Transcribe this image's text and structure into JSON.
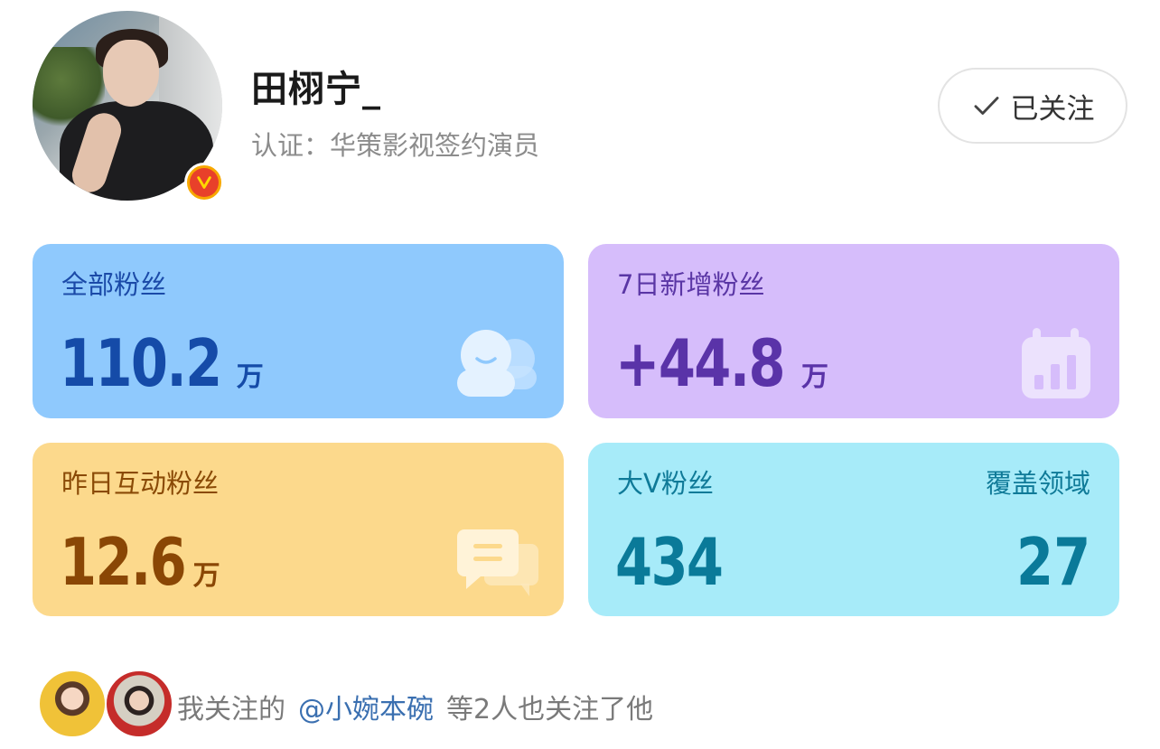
{
  "profile": {
    "username": "田栩宁_",
    "verification": "认证：华策影视签约演员",
    "avatar_icon": "user-avatar",
    "badge_icon": "verified-v-badge",
    "follow_button": {
      "label": "已关注",
      "icon": "check-icon"
    }
  },
  "stats": {
    "total_fans": {
      "label": "全部粉丝",
      "value": "110.2",
      "unit": "万",
      "icon": "fans-faces-icon",
      "color": "#8fc9fd"
    },
    "new_fans_7d": {
      "label": "7日新增粉丝",
      "value": "+44.8",
      "unit": "万",
      "icon": "bar-chart-calendar-icon",
      "color": "#d6bdfb"
    },
    "yesterday_interact": {
      "label": "昨日互动粉丝",
      "value": "12.6",
      "unit": "万",
      "icon": "chat-bubbles-icon",
      "color": "#fcd98c"
    },
    "bigv_fans": {
      "label": "大V粉丝",
      "value": "434",
      "coverage_label": "覆盖领域",
      "coverage_value": "27",
      "color": "#a7ebf9"
    }
  },
  "footer": {
    "prefix": "我关注的",
    "mention": "@小婉本碗",
    "suffix": "等2人也关注了他"
  }
}
